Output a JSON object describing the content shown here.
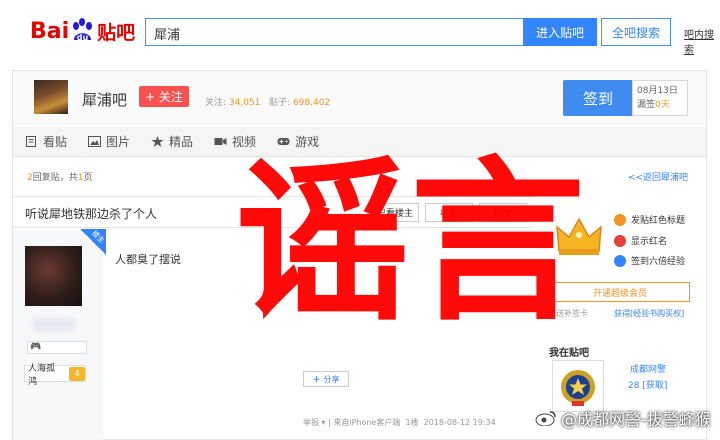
{
  "topbar": {
    "logo_bai": "Bai",
    "logo_du": "du",
    "logo_tieba": "贴吧",
    "search_value": "犀浦",
    "enter_bar_label": "进入贴吧",
    "all_search_label": "全吧搜索",
    "in_bar_search_label": "吧内搜索"
  },
  "forum": {
    "name": "犀浦吧",
    "follow_label": "+ 关注",
    "followers_label": "关注:",
    "followers_count": "34,051",
    "posts_label": "贴子:",
    "posts_count": "698,402",
    "signin_label": "签到",
    "sign_date": "08月13日",
    "sign_streak_prefix": "漏签",
    "sign_streak_value": "0天"
  },
  "tabs": [
    {
      "label": "看贴",
      "icon": "document-icon"
    },
    {
      "label": "图片",
      "icon": "image-icon"
    },
    {
      "label": "精品",
      "icon": "star-icon"
    },
    {
      "label": "视频",
      "icon": "video-icon"
    },
    {
      "label": "游戏",
      "icon": "gamepad-icon"
    }
  ],
  "pagebar": {
    "reply_count": "2",
    "reply_text": "回复贴，共",
    "page_count": "1",
    "page_text": "页",
    "back_link": "<<返回犀浦吧"
  },
  "thread": {
    "title": "听说犀地铁那边杀了个人",
    "only_op_label": "只看楼主",
    "favorite_label": "收藏",
    "reply_label": "回复"
  },
  "post": {
    "op_badge": "楼主",
    "user_icon": "🎮",
    "level_name": "人海孤鸿",
    "level_num": "4",
    "content": "人都臭了摆说",
    "share_label": "分享",
    "meta_report": "举报",
    "meta_source": "| 来自iPhone客户端",
    "meta_floor": "1楼",
    "meta_time": "2018-08-12 19:34"
  },
  "sidebar": {
    "perks": [
      {
        "label": "发贴红色标题",
        "color": "#f7931e"
      },
      {
        "label": "显示红名",
        "color": "#e8403a"
      },
      {
        "label": "签到六倍经验",
        "color": "#3385ff"
      }
    ],
    "member_label": "开通超级会员",
    "card_link": "赠送补签卡",
    "exp_link": "获得[经验书购买权]",
    "related_title": "我在贴吧",
    "police_name": "成都网警",
    "police_count": "28 [获取]"
  },
  "overlay": {
    "rumor_text": "谣言",
    "weibo_watermark": "@成都网警-拔警蜂猴",
    "rumor_color": "#ff0000"
  }
}
